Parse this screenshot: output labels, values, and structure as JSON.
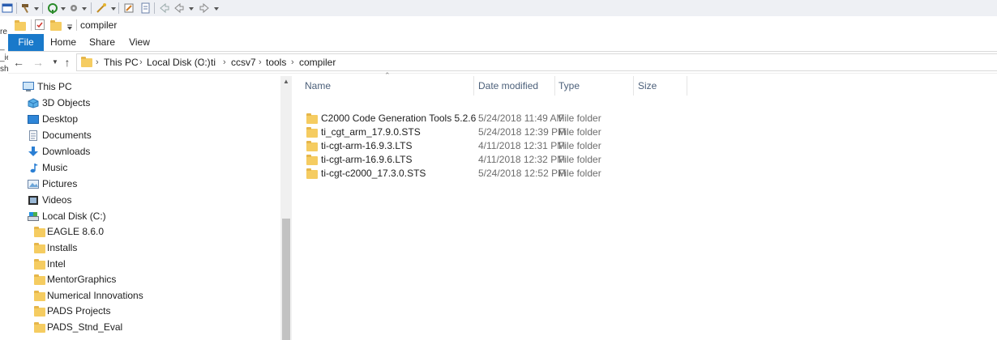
{
  "window": {
    "title": "compiler"
  },
  "ribbon": {
    "tabs": [
      {
        "label": "File"
      },
      {
        "label": "Home"
      },
      {
        "label": "Share"
      },
      {
        "label": "View"
      }
    ]
  },
  "address": {
    "root_label": "This PC",
    "crumbs": [
      "This PC",
      "Local Disk (C:)",
      "ti",
      "ccsv7",
      "tools",
      "compiler"
    ]
  },
  "nav_pane": {
    "items": [
      {
        "label": "This PC",
        "icon": "computer-icon"
      },
      {
        "label": "3D Objects",
        "icon": "3d-objects-icon"
      },
      {
        "label": "Desktop",
        "icon": "desktop-icon"
      },
      {
        "label": "Documents",
        "icon": "documents-icon"
      },
      {
        "label": "Downloads",
        "icon": "downloads-icon"
      },
      {
        "label": "Music",
        "icon": "music-icon"
      },
      {
        "label": "Pictures",
        "icon": "pictures-icon"
      },
      {
        "label": "Videos",
        "icon": "videos-icon"
      },
      {
        "label": "Local Disk (C:)",
        "icon": "drive-icon"
      },
      {
        "label": "EAGLE 8.6.0",
        "icon": "folder-icon"
      },
      {
        "label": "Installs",
        "icon": "folder-icon"
      },
      {
        "label": "Intel",
        "icon": "folder-icon"
      },
      {
        "label": "MentorGraphics",
        "icon": "folder-icon"
      },
      {
        "label": "Numerical Innovations",
        "icon": "folder-icon"
      },
      {
        "label": "PADS Projects",
        "icon": "folder-icon"
      },
      {
        "label": "PADS_Stnd_Eval",
        "icon": "folder-icon"
      }
    ]
  },
  "file_list": {
    "columns": [
      "Name",
      "Date modified",
      "Type",
      "Size"
    ],
    "rows": [
      {
        "name": "C2000 Code Generation Tools 5.2.6",
        "date": "5/24/2018 11:49 AM",
        "type": "File folder",
        "size": ""
      },
      {
        "name": "ti_cgt_arm_17.9.0.STS",
        "date": "5/24/2018 12:39 PM",
        "type": "File folder",
        "size": ""
      },
      {
        "name": "ti-cgt-arm-16.9.3.LTS",
        "date": "4/11/2018 12:31 PM",
        "type": "File folder",
        "size": ""
      },
      {
        "name": "ti-cgt-arm-16.9.6.LTS",
        "date": "4/11/2018 12:32 PM",
        "type": "File folder",
        "size": ""
      },
      {
        "name": "ti-cgt-c2000_17.3.0.STS",
        "date": "5/24/2018 12:52 PM",
        "type": "File folder",
        "size": ""
      }
    ]
  },
  "colors": {
    "accent": "#1979ca",
    "folder": "#f5cc61",
    "header_text": "#4c607a"
  }
}
